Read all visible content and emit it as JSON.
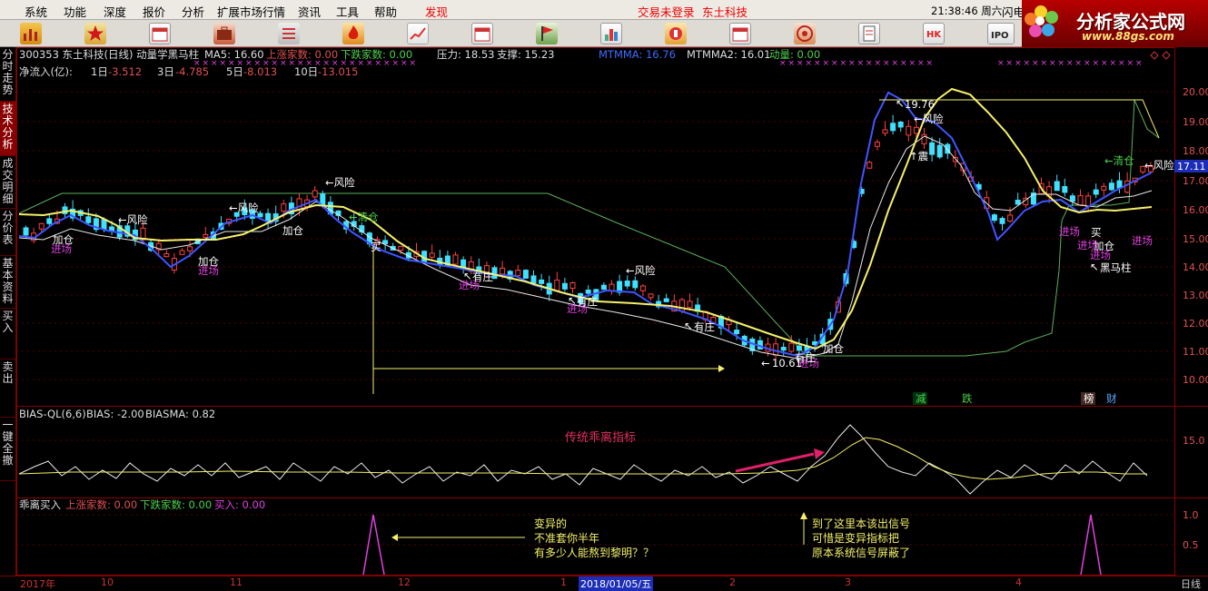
{
  "menu": {
    "items": [
      "系统",
      "功能",
      "深度",
      "报价",
      "分析",
      "扩展市场行情",
      "资讯",
      "工具",
      "帮助",
      "发现"
    ],
    "status_left": "交易未登录",
    "status_right": "东土科技",
    "clock": "21:38:46 周六",
    "right_tab": "闪电"
  },
  "logo": {
    "title": "分析家公式网",
    "url": "www.88gs.com"
  },
  "toolbar_icons": [
    "chart-icon",
    "star-icon",
    "calendar-icon",
    "briefcase-icon",
    "list-icon",
    "fire-icon",
    "trend-icon",
    "calendar-icon",
    "flag-icon",
    "ranking-icon",
    "news-icon",
    "calendar-icon",
    "target-icon",
    "document-icon",
    "hk-icon",
    "ipo-icon"
  ],
  "toolbar_labels": {
    "hk": "HK",
    "ipo": "IPO"
  },
  "left_tabs": [
    "分时走势",
    "技术分析",
    "成交明细",
    "分价表",
    "基本资料",
    "买入",
    "卖出",
    "一键全撤"
  ],
  "main": {
    "code_name": "300353 东土科技(日线) 动量学黑马柱",
    "ma5": "MA5: 16.60",
    "up_count": "上涨家数: 0.00",
    "down_count": "下跌家数: 0.00",
    "pressure": "压力: 18.53",
    "support": "支撑: 15.23",
    "mtmma": "MTMMA: 16.76",
    "mtmma2": "MTMMA2: 16.01",
    "momentum": "动量: 0.00",
    "flow_label": "净流入(亿):",
    "flow": [
      {
        "period": "1日",
        "value": "-3.512"
      },
      {
        "period": "3日",
        "value": "-4.785"
      },
      {
        "period": "5日",
        "value": "-8.013"
      },
      {
        "period": "10日",
        "value": "-13.015"
      }
    ],
    "price_axis": [
      "20.00",
      "19.00",
      "18.00",
      "17.00",
      "16.00",
      "15.00",
      "14.00",
      "13.00",
      "12.00",
      "11.00",
      "10.00"
    ],
    "current_price": "17.11",
    "high_mark": "19.76",
    "low_mark": "10.61",
    "signals": {
      "risk": "←风险",
      "add": "加仓",
      "enter": "进场",
      "clear": "←清仓",
      "zhuang": "有庄",
      "buy": "买",
      "black_horse": "黑马柱",
      "shake": "↑震"
    },
    "bottom_tags": [
      "减",
      "跌",
      "榜",
      "财"
    ]
  },
  "bias": {
    "title": "BIAS-QL(6,6)",
    "bias": "BIAS: -2.00",
    "biasma": "BIASMA: 0.82",
    "annotation": "传统乖离指标",
    "axis": "15.0"
  },
  "buy": {
    "title": "乖离买入",
    "up_count": "上涨家数: 0.00",
    "down_count": "下跌家数: 0.00",
    "buy_value": "买入: 0.00",
    "note1": [
      "变异的",
      "不准套你半年",
      "有多少人能熬到黎明？？"
    ],
    "note2": [
      "到了这里本该出信号",
      "可惜是变异指标把",
      "原本系统信号屏蔽了"
    ],
    "axis": [
      "1.0",
      "0.5"
    ]
  },
  "dates": {
    "labels": [
      "2017年",
      "10",
      "11",
      "12",
      "1",
      "2018/01/05/五",
      "2",
      "3",
      "4"
    ],
    "period": "日线"
  }
}
